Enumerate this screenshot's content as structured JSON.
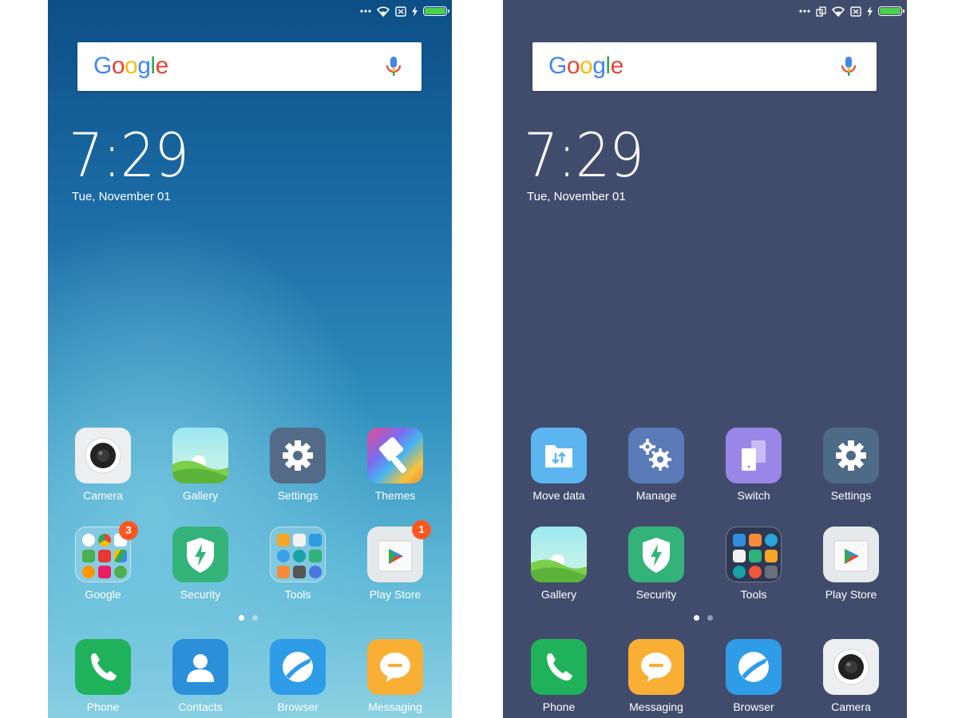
{
  "left": {
    "google_logo": [
      "G",
      "o",
      "o",
      "g",
      "l",
      "e"
    ],
    "clock": "7:29",
    "date": "Tue, November 01",
    "apps_row1": [
      "Camera",
      "Gallery",
      "Settings",
      "Themes"
    ],
    "apps_row2": [
      "Google",
      "Security",
      "Tools",
      "Play Store"
    ],
    "dock": [
      "Phone",
      "Contacts",
      "Browser",
      "Messaging"
    ],
    "badges": {
      "google": "3",
      "play_store": "1"
    },
    "page_indicator": {
      "pages": 2,
      "active": 1
    }
  },
  "right": {
    "google_logo": [
      "G",
      "o",
      "o",
      "g",
      "l",
      "e"
    ],
    "clock": "7:29",
    "date": "Tue, November 01",
    "apps_row1": [
      "Move data",
      "Manage",
      "Switch",
      "Settings"
    ],
    "apps_row2": [
      "Gallery",
      "Security",
      "Tools",
      "Play Store"
    ],
    "dock": [
      "Phone",
      "Messaging",
      "Browser",
      "Camera"
    ],
    "page_indicator": {
      "pages": 2,
      "active": 1
    }
  },
  "colors": {
    "google_blue": "#4285f4",
    "google_red": "#ea4335",
    "google_yellow": "#fbbc05",
    "google_green": "#34a853",
    "badge": "#ff5722",
    "battery_fill": "#4cd04c"
  },
  "status_icons": [
    "more-dots-icon",
    "wifi-icon",
    "no-sim-icon",
    "charging-icon",
    "battery-icon"
  ],
  "status_icons_right_extra": [
    "screen-rotate-icon"
  ]
}
